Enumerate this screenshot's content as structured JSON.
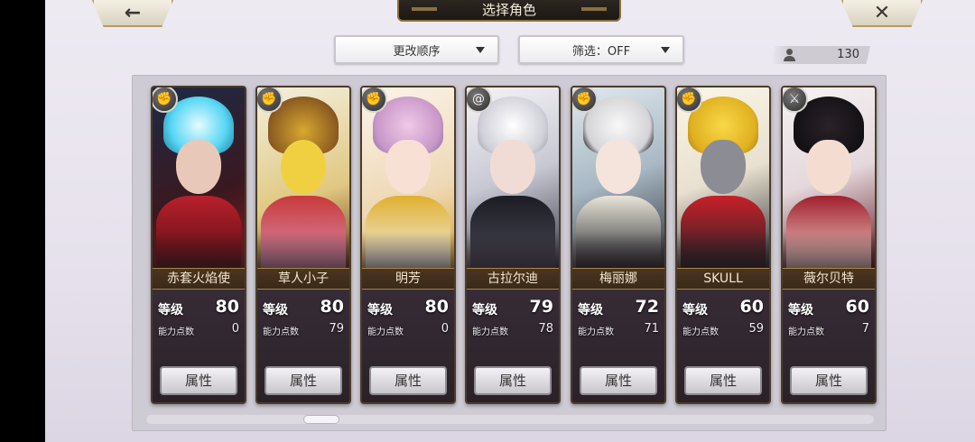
{
  "header": {
    "title": "选择角色",
    "back_icon": "←",
    "close_icon": "✕"
  },
  "controls": {
    "order_label": "更改顺序",
    "filter_label": "筛选：OFF",
    "character_count": "130"
  },
  "labels": {
    "level": "等级",
    "points": "能力点数",
    "attr_button": "属性"
  },
  "characters": [
    {
      "name": "赤套火焰使",
      "level": "80",
      "points": "0",
      "role_icon": "fist-icon"
    },
    {
      "name": "草人小子",
      "level": "80",
      "points": "79",
      "role_icon": "fist-icon"
    },
    {
      "name": "明芳",
      "level": "80",
      "points": "0",
      "role_icon": "fist-icon"
    },
    {
      "name": "古拉尔迪",
      "level": "79",
      "points": "78",
      "role_icon": "spiral-icon"
    },
    {
      "name": "梅丽娜",
      "level": "72",
      "points": "71",
      "role_icon": "fist-icon"
    },
    {
      "name": "SKULL",
      "level": "60",
      "points": "59",
      "role_icon": "fist-icon"
    },
    {
      "name": "薇尔贝特",
      "level": "60",
      "points": "7",
      "role_icon": "sword-icon"
    }
  ]
}
